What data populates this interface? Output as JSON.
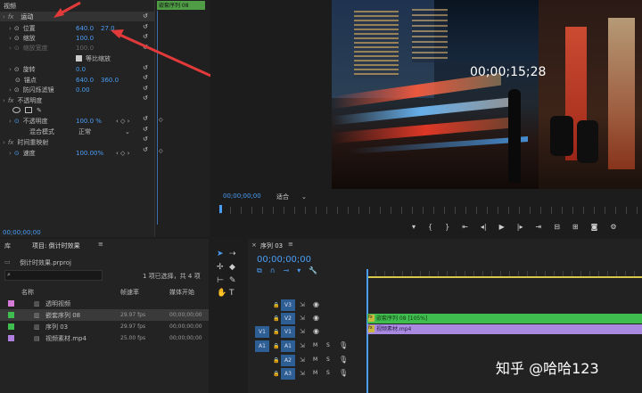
{
  "effect_controls": {
    "title": "视频",
    "clip_tab": "嵌套序列 08",
    "motion": "运动",
    "position_label": "位置",
    "position_x": "640.0",
    "position_y": "27.0",
    "scale_label": "缩放",
    "scale_value": "100.0",
    "scale_width_label": "缩放宽度",
    "scale_width_value": "100.0",
    "uniform_scale_label": "等比缩放",
    "rotation_label": "旋转",
    "rotation_value": "0.0",
    "anchor_label": "锚点",
    "anchor_x": "640.0",
    "anchor_y": "360.0",
    "antiflicker_label": "防闪烁滤镜",
    "antiflicker_value": "0.00",
    "opacity_section": "不透明度",
    "opacity_label": "不透明度",
    "opacity_value": "100.0 %",
    "blend_label": "混合模式",
    "blend_value": "正常",
    "time_remap": "时间重映射",
    "speed_label": "速度",
    "speed_value": "100.00%",
    "timecode": "00;00;00;00"
  },
  "program_monitor": {
    "overlay_timecode": "00;00;15;28",
    "timecode": "00;00;00;00",
    "fit_label": "适合"
  },
  "project_panel": {
    "tab_library": "库",
    "tab_project": "项目: 倒计时效果",
    "file_name": "倒计时效果.prproj",
    "selection_info": "1 项已选择，共 4 项",
    "headers": [
      "名称",
      "帧速率",
      "媒体开始"
    ],
    "items": [
      {
        "name": "透明视频",
        "fps": "",
        "start": "",
        "color": "#d67ad8"
      },
      {
        "name": "嵌套序列 08",
        "fps": "29.97 fps",
        "start": "00;00;00;00",
        "color": "#3fbd4e"
      },
      {
        "name": "序列 03",
        "fps": "29.97 fps",
        "start": "00;00;00;00",
        "color": "#3fbd4e"
      },
      {
        "name": "视频素材.mp4",
        "fps": "25.00 fps",
        "start": "00;00;00;00",
        "color": "#b07fe0"
      }
    ]
  },
  "timeline": {
    "tab": "序列 03",
    "timecode": "00;00;00;00",
    "video_tracks": [
      "V3",
      "V2",
      "V1"
    ],
    "audio_tracks": [
      "A1",
      "A2",
      "A3"
    ],
    "source_v": "V1",
    "source_a": "A1",
    "clip_nested": "嵌套序列 08 [105%]",
    "clip_video": "视频素材.mp4"
  },
  "watermark": "知乎 @哈哈123",
  "colors": {
    "accent": "#4a9df5",
    "green_clip": "#3fbd4e",
    "violet_clip": "#a98ae0"
  }
}
